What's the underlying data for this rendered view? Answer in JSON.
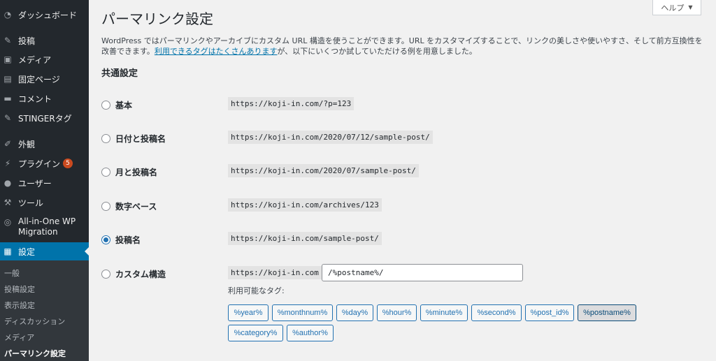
{
  "sidebar": {
    "items": [
      {
        "label": "ダッシュボード",
        "icon": "dashboard-icon",
        "glyph": "◔"
      },
      {
        "label": "投稿",
        "icon": "pin-icon",
        "glyph": "✎"
      },
      {
        "label": "メディア",
        "icon": "media-icon",
        "glyph": "▣"
      },
      {
        "label": "固定ページ",
        "icon": "page-icon",
        "glyph": "▤"
      },
      {
        "label": "コメント",
        "icon": "comment-icon",
        "glyph": "▬"
      },
      {
        "label": "STINGERタグ",
        "icon": "pin-icon",
        "glyph": "✎"
      },
      {
        "label": "外観",
        "icon": "brush-icon",
        "glyph": "✐"
      },
      {
        "label": "プラグイン",
        "icon": "plugin-icon",
        "glyph": "⚡",
        "badge": "5"
      },
      {
        "label": "ユーザー",
        "icon": "user-icon",
        "glyph": "●"
      },
      {
        "label": "ツール",
        "icon": "wrench-icon",
        "glyph": "⚒"
      },
      {
        "label": "All-in-One WP Migration",
        "icon": "migration-icon",
        "glyph": "◎"
      },
      {
        "label": "設定",
        "icon": "settings-icon",
        "glyph": "▦"
      }
    ],
    "submenu": [
      "一般",
      "投稿設定",
      "表示設定",
      "ディスカッション",
      "メディア",
      "パーマリンク設定"
    ]
  },
  "help": {
    "label": "ヘルプ",
    "caret": "▼"
  },
  "page": {
    "title": "パーマリンク設定",
    "intro_before": "WordPress ではパーマリンクやアーカイブにカスタム URL 構造を使うことができます。URL をカスタマイズすることで、リンクの美しさや使いやすさ、そして前方互換性を改善できます。",
    "intro_link": "利用できるタグはたくさんあります",
    "intro_after": "が、以下にいくつか試していただける例を用意しました。",
    "section_title": "共通設定"
  },
  "options": [
    {
      "label": "基本",
      "example": "https://koji-in.com/?p=123",
      "checked": false
    },
    {
      "label": "日付と投稿名",
      "example": "https://koji-in.com/2020/07/12/sample-post/",
      "checked": false
    },
    {
      "label": "月と投稿名",
      "example": "https://koji-in.com/2020/07/sample-post/",
      "checked": false
    },
    {
      "label": "数字ベース",
      "example": "https://koji-in.com/archives/123",
      "checked": false
    },
    {
      "label": "投稿名",
      "example": "https://koji-in.com/sample-post/",
      "checked": true
    },
    {
      "label": "カスタム構造",
      "example": "https://koji-in.com",
      "checked": false
    }
  ],
  "custom": {
    "value": "/%postname%/",
    "available_tags_label": "利用可能なタグ:",
    "tags": [
      "%year%",
      "%monthnum%",
      "%day%",
      "%hour%",
      "%minute%",
      "%second%",
      "%post_id%",
      "%postname%",
      "%category%",
      "%author%"
    ],
    "active_tag": "%postname%"
  }
}
